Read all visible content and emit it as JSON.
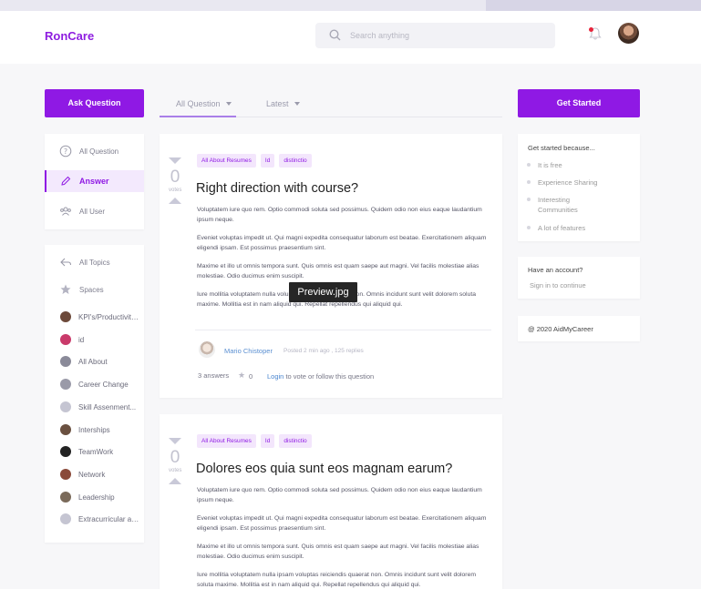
{
  "app": {
    "logo": "RonCare"
  },
  "search": {
    "placeholder": "Search anything"
  },
  "buttons": {
    "ask": "Ask Question",
    "get_started": "Get Started"
  },
  "tabs": {
    "all": "All Question",
    "latest": "Latest"
  },
  "sidebar": {
    "nav": [
      {
        "label": "All Question",
        "icon": "question-circle-icon"
      },
      {
        "label": "Answer",
        "icon": "pencil-icon",
        "active": true
      },
      {
        "label": "All User",
        "icon": "users-icon"
      }
    ],
    "topics_label": "All Topics",
    "spaces_label": "Spaces",
    "topics": [
      {
        "label": "KPI's/Productivity...",
        "color": "#6d4a3b"
      },
      {
        "label": "id",
        "color": "#c93a6a"
      },
      {
        "label": "All About",
        "color": "#8a8a99"
      },
      {
        "label": "Career Change",
        "color": "#9a9aa8"
      },
      {
        "label": "Skill Assenment...",
        "color": "#c5c5d2"
      },
      {
        "label": "Interships",
        "color": "#6a5040"
      },
      {
        "label": "TeamWork",
        "color": "#222222"
      },
      {
        "label": "Network",
        "color": "#8a4a3a"
      },
      {
        "label": "Leadership",
        "color": "#7a6a5a"
      },
      {
        "label": "Extracurricular ac...",
        "color": "#c5c5d2"
      }
    ]
  },
  "questions": [
    {
      "votes": "0",
      "votes_label": "votes",
      "tags": [
        "All About Resumes",
        "Id",
        "distinctio"
      ],
      "title": "Right direction with course?",
      "paragraphs": [
        "Voluptatem iure quo rem. Optio commodi soluta sed possimus. Quidem odio non eius eaque laudantium ipsum neque.",
        "Eveniet voluptas impedit ut. Qui magni expedita consequatur laborum est beatae. Exercitationem aliquam eligendi ipsam. Est possimus praesentium sint.",
        "Maxime et illo ut omnis tempora sunt. Quis omnis est quam saepe aut magni. Vel facilis molestiae alias molestiae. Odio ducimus enim suscipit.",
        "Iure mollitia voluptatem nulla voluptas reiciendis quaerat non. Omnis incidunt sunt velit dolorem soluta maxime. Mollitia est in nam aliquid qui. Repellat repellendus qui aliquid qui."
      ],
      "author": "Mario Chistoper",
      "meta": "Posted 2 min ago , 125 replies",
      "answers": "3 answers",
      "stars": "0",
      "login_link": "Login",
      "login_rest": " to vote or follow this question"
    },
    {
      "votes": "0",
      "votes_label": "votes",
      "tags": [
        "All About Resumes",
        "Id",
        "distinctio"
      ],
      "title": "Dolores eos quia sunt eos magnam earum?",
      "paragraphs": [
        "Voluptatem iure quo rem. Optio commodi soluta sed possimus. Quidem odio non eius eaque laudantium ipsum neque.",
        "Eveniet voluptas impedit ut. Qui magni expedita consequatur laborum est beatae. Exercitationem aliquam eligendi ipsam. Est possimus praesentium sint.",
        "Maxime et illo ut omnis tempora sunt. Quis omnis est quam saepe aut magni. Vel facilis molestiae alias molestiae. Odio ducimus enim suscipit.",
        "Iure mollitia voluptatem nulla ipsam voluptas reiciendis quaerat non. Omnis incidunt sunt velit dolorem soluta maxime. Mollitia est in nam aliquid qui. Repellat repellendus qui aliquid qui."
      ]
    }
  ],
  "tooltip": "Preview.jpg",
  "right": {
    "card1_title": "Get started because...",
    "card1_items": [
      "It is free",
      "Experience Sharing",
      "Interesting Communities",
      "A lot of features"
    ],
    "card2_title": "Have an account?",
    "card2_link": "Sign in to continue",
    "footer": "@ 2020 AidMyCareer"
  },
  "colors": {
    "accent": "#8f19e4",
    "link": "#4a86d0"
  }
}
